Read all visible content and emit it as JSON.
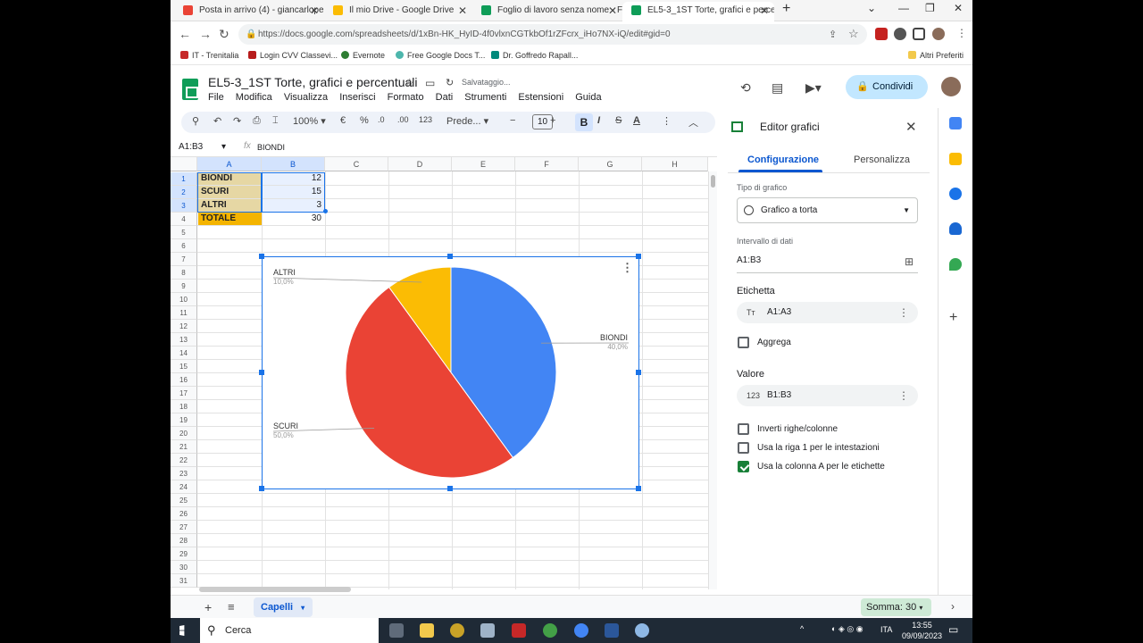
{
  "browser": {
    "tabs": [
      {
        "label": "Posta in arrivo (4) - giancarloper…",
        "icon": "gmail-icon",
        "color": "#ea4335"
      },
      {
        "label": "Il mio Drive - Google Drive",
        "icon": "drive-icon",
        "color": "#fbbc04"
      },
      {
        "label": "Foglio di lavoro senza nome - Fo…",
        "icon": "sheets-icon",
        "color": "#0f9d58"
      },
      {
        "label": "EL5-3_1ST Torte, grafici e percent…",
        "icon": "sheets-icon",
        "color": "#0f9d58"
      }
    ],
    "url": "https://docs.google.com/spreadsheets/d/1xBn-HK_HyID-4f0vlxnCGTkbOf1rZFcrx_iHo7NX-iQ/edit#gid=0",
    "bookmarks": [
      "IT - Trenitalia",
      "Login CVV Classevi...",
      "Evernote",
      "Free Google Docs T...",
      "Dr. Goffredo Rapall..."
    ],
    "other_bookmarks": "Altri Preferiti"
  },
  "sheets": {
    "title": "EL5-3_1ST Torte, grafici e percentuali",
    "saving": "Salvataggio...",
    "menus": [
      "File",
      "Modifica",
      "Visualizza",
      "Inserisci",
      "Formato",
      "Dati",
      "Strumenti",
      "Estensioni",
      "Guida"
    ],
    "share_label": "Condividi",
    "toolbar": {
      "zoom": "100%",
      "currency": "€",
      "percent": "%",
      "dec_less": ".0",
      "dec_more": ".00",
      "format_num": "123",
      "font": "Prede...",
      "font_size": "10"
    },
    "name_box": "A1:B3",
    "formula_content": "BIONDI",
    "columns": [
      "A",
      "B",
      "C",
      "D",
      "E",
      "F",
      "G",
      "H"
    ],
    "rows": [
      "1",
      "2",
      "3",
      "4",
      "5",
      "6",
      "7",
      "8",
      "9",
      "10",
      "11",
      "12",
      "13",
      "14",
      "15",
      "16",
      "17",
      "18",
      "19",
      "20",
      "21",
      "22",
      "23",
      "24",
      "25",
      "26",
      "27",
      "28",
      "29",
      "30",
      "31"
    ],
    "cells": [
      {
        "a": "BIONDI",
        "b": "12"
      },
      {
        "a": "SCURI",
        "b": "15"
      },
      {
        "a": "ALTRI",
        "b": "3"
      },
      {
        "a": "TOTALE",
        "b": "30"
      }
    ],
    "sheet_tab": "Capelli",
    "sum_label": "Somma: 30"
  },
  "chart_data": {
    "type": "pie",
    "categories": [
      "BIONDI",
      "SCURI",
      "ALTRI"
    ],
    "values": [
      12,
      15,
      3
    ],
    "percent_labels": [
      "40,0%",
      "50,0%",
      "10,0%"
    ],
    "colors": [
      "#4285f4",
      "#ea4335",
      "#fbbc04"
    ]
  },
  "editor": {
    "title": "Editor grafici",
    "tab_config": "Configurazione",
    "tab_custom": "Personalizza",
    "chart_type_label": "Tipo di grafico",
    "chart_type_value": "Grafico a torta",
    "range_label": "Intervallo di dati",
    "range_value": "A1:B3",
    "label_section": "Etichetta",
    "label_value": "A1:A3",
    "aggregate": "Aggrega",
    "value_section": "Valore",
    "value_value": "B1:B3",
    "checks": [
      {
        "label": "Inverti righe/colonne",
        "checked": false
      },
      {
        "label": "Usa la riga 1 per le intestazioni",
        "checked": false
      },
      {
        "label": "Usa la colonna A per le etichette",
        "checked": true
      }
    ]
  },
  "taskbar": {
    "search_label": "Cerca",
    "lang": "ITA",
    "time": "13:55",
    "date": "09/09/2023"
  }
}
